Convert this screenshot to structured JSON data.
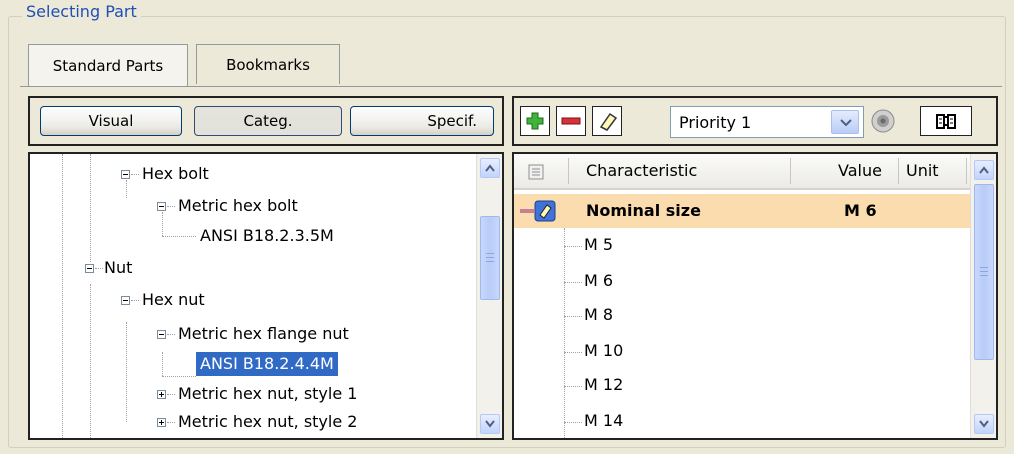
{
  "group_title": "Selecting Part",
  "tabs": [
    {
      "label": "Standard Parts",
      "active": true
    },
    {
      "label": "Bookmarks",
      "active": false
    }
  ],
  "view_buttons": {
    "visual": "Visual",
    "categ": "Categ.",
    "specif": "Specif."
  },
  "tree": {
    "items": [
      {
        "label": "Hex bolt",
        "toggle": "minus"
      },
      {
        "label": "Metric hex bolt",
        "toggle": "minus"
      },
      {
        "label": "ANSI B18.2.3.5M",
        "toggle": "none"
      },
      {
        "label": "Nut",
        "toggle": "minus"
      },
      {
        "label": "Hex nut",
        "toggle": "minus"
      },
      {
        "label": "Metric hex flange nut",
        "toggle": "minus"
      },
      {
        "label": "ANSI B18.2.4.4M",
        "toggle": "none",
        "selected": true
      },
      {
        "label": "Metric hex nut, style 1",
        "toggle": "plus"
      },
      {
        "label": "Metric hex nut, style 2",
        "toggle": "plus"
      }
    ]
  },
  "toolbar": {
    "add_icon": "plus-icon",
    "remove_icon": "minus-icon",
    "eraser_icon": "eraser-icon",
    "priority_value": "Priority 1",
    "sphere_icon": "sphere-icon",
    "book_icon": "book-icon"
  },
  "grid": {
    "columns": {
      "characteristic": "Characteristic",
      "value": "Value",
      "unit": "Unit"
    },
    "header_row": {
      "label": "Nominal size",
      "value": "M 6"
    },
    "options": [
      "M 5",
      "M 6",
      "M 8",
      "M 10",
      "M 12",
      "M 14"
    ]
  },
  "colors": {
    "selection": "#316ac5",
    "highlight_row": "#fbdcae",
    "accent_title": "#1f4fb4"
  }
}
